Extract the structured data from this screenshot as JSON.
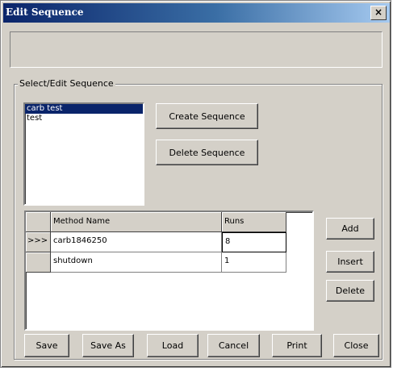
{
  "window": {
    "title": "Edit Sequence",
    "close_label": "×"
  },
  "group": {
    "label": "Select/Edit Sequence"
  },
  "sequence_list": {
    "items": [
      "carb test",
      "test"
    ],
    "selected_index": 0
  },
  "buttons": {
    "create_sequence": "Create Sequence",
    "delete_sequence": "Delete Sequence",
    "add": "Add",
    "insert": "Insert",
    "delete": "Delete",
    "save": "Save",
    "save_as": "Save As",
    "load": "Load",
    "cancel": "Cancel",
    "print": "Print",
    "close": "Close"
  },
  "grid": {
    "columns": [
      "Method Name",
      "Runs"
    ],
    "rows": [
      {
        "indicator": ">>>",
        "method": "carb1846250",
        "runs": "8"
      },
      {
        "indicator": "",
        "method": "shutdown",
        "runs": "1"
      }
    ]
  }
}
